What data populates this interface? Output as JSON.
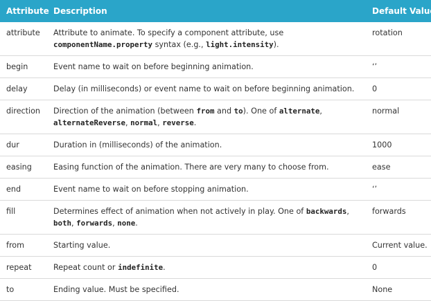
{
  "header": {
    "attribute": "Attribute",
    "description": "Description",
    "default": "Default Value"
  },
  "rows": [
    {
      "attr": "attribute",
      "default": "rotation",
      "desc": [
        {
          "t": "Attribute to animate. To specify a component attribute, use "
        },
        {
          "c": "componentName.property"
        },
        {
          "t": " syntax (e.g., "
        },
        {
          "c": "light.intensity"
        },
        {
          "t": ")."
        }
      ]
    },
    {
      "attr": "begin",
      "default": "‘’",
      "desc": [
        {
          "t": "Event name to wait on before beginning animation."
        }
      ]
    },
    {
      "attr": "delay",
      "default": "0",
      "desc": [
        {
          "t": "Delay (in milliseconds) or event name to wait on before beginning animation."
        }
      ]
    },
    {
      "attr": "direction",
      "default": "normal",
      "desc": [
        {
          "t": "Direction of the animation (between "
        },
        {
          "c": "from"
        },
        {
          "t": " and "
        },
        {
          "c": "to"
        },
        {
          "t": "). One of "
        },
        {
          "c": "alternate"
        },
        {
          "t": ", "
        },
        {
          "c": "alternateReverse"
        },
        {
          "t": ", "
        },
        {
          "c": "normal"
        },
        {
          "t": ", "
        },
        {
          "c": "reverse"
        },
        {
          "t": "."
        }
      ]
    },
    {
      "attr": "dur",
      "default": "1000",
      "desc": [
        {
          "t": "Duration in (milliseconds) of the animation."
        }
      ]
    },
    {
      "attr": "easing",
      "default": "ease",
      "desc": [
        {
          "t": "Easing function of the animation. There are very many to choose from."
        }
      ]
    },
    {
      "attr": "end",
      "default": "‘’",
      "desc": [
        {
          "t": "Event name to wait on before stopping animation."
        }
      ]
    },
    {
      "attr": "fill",
      "default": "forwards",
      "desc": [
        {
          "t": "Determines effect of animation when not actively in play. One of "
        },
        {
          "c": "backwards"
        },
        {
          "t": ", "
        },
        {
          "c": "both"
        },
        {
          "t": ", "
        },
        {
          "c": "forwards"
        },
        {
          "t": ", "
        },
        {
          "c": "none"
        },
        {
          "t": "."
        }
      ]
    },
    {
      "attr": "from",
      "default": "Current value.",
      "desc": [
        {
          "t": "Starting value."
        }
      ]
    },
    {
      "attr": "repeat",
      "default": "0",
      "desc": [
        {
          "t": "Repeat count or "
        },
        {
          "c": "indefinite"
        },
        {
          "t": "."
        }
      ]
    },
    {
      "attr": "to",
      "default": "None",
      "desc": [
        {
          "t": "Ending value. Must be specified."
        }
      ]
    }
  ]
}
